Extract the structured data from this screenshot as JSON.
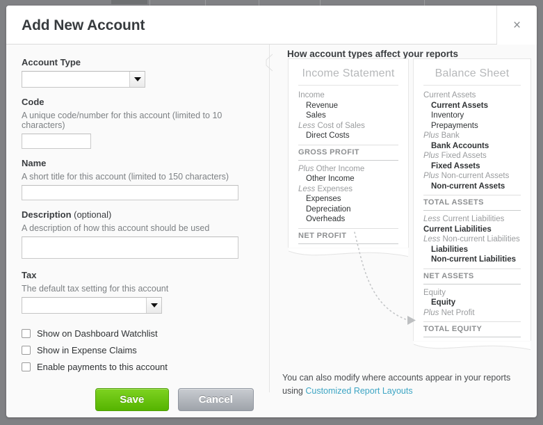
{
  "modal": {
    "title": "Add New Account",
    "close_icon": "close-icon",
    "close_glyph": "×"
  },
  "form": {
    "account_type": {
      "label": "Account Type",
      "value": "",
      "arrow_icon": "chevron-down-icon"
    },
    "code": {
      "label": "Code",
      "help": "A unique code/number for this account (limited to 10 characters)",
      "value": ""
    },
    "name": {
      "label": "Name",
      "help": "A short title for this account (limited to 150 characters)",
      "value": ""
    },
    "description": {
      "label": "Description",
      "optional_suffix": " (optional)",
      "help": "A description of how this account should be used",
      "value": ""
    },
    "tax": {
      "label": "Tax",
      "help": "The default tax setting for this account",
      "value": "",
      "arrow_icon": "chevron-down-icon"
    },
    "checkboxes": [
      {
        "label": "Show on Dashboard Watchlist",
        "checked": false
      },
      {
        "label": "Show in Expense Claims",
        "checked": false
      },
      {
        "label": "Enable payments to this account",
        "checked": false
      }
    ],
    "buttons": {
      "save": "Save",
      "cancel": "Cancel"
    }
  },
  "info": {
    "heading": "How account types affect your reports",
    "footer_text": "You can also modify where accounts appear in your reports using ",
    "footer_link": "Customized Report Layouts",
    "income_statement": {
      "title": "Income Statement",
      "rows": [
        {
          "type": "group",
          "kw": "",
          "text": "Income"
        },
        {
          "type": "item",
          "text": "Revenue"
        },
        {
          "type": "item",
          "text": "Sales"
        },
        {
          "type": "group",
          "kw": "Less ",
          "text": "Cost of Sales"
        },
        {
          "type": "item",
          "text": "Direct Costs"
        },
        {
          "type": "total",
          "text": "GROSS PROFIT"
        },
        {
          "type": "group",
          "kw": "Plus ",
          "text": "Other Income"
        },
        {
          "type": "item",
          "text": "Other Income"
        },
        {
          "type": "group",
          "kw": "Less ",
          "text": "Expenses"
        },
        {
          "type": "item",
          "text": "Expenses"
        },
        {
          "type": "item",
          "text": "Depreciation"
        },
        {
          "type": "item",
          "text": "Overheads"
        },
        {
          "type": "total",
          "text": "NET PROFIT"
        }
      ]
    },
    "balance_sheet": {
      "title": "Balance Sheet",
      "rows": [
        {
          "type": "group",
          "kw": "",
          "text": "Current Assets"
        },
        {
          "type": "item",
          "bold": true,
          "text": "Current Assets"
        },
        {
          "type": "item",
          "text": "Inventory"
        },
        {
          "type": "item",
          "text": "Prepayments"
        },
        {
          "type": "group",
          "kw": "Plus ",
          "text": "Bank"
        },
        {
          "type": "item",
          "bold": true,
          "text": "Bank Accounts"
        },
        {
          "type": "group",
          "kw": "Plus ",
          "text": "Fixed Assets"
        },
        {
          "type": "item",
          "bold": true,
          "text": "Fixed Assets"
        },
        {
          "type": "group",
          "kw": "Plus ",
          "text": "Non-current Assets"
        },
        {
          "type": "item",
          "bold": true,
          "text": "Non-current Assets"
        },
        {
          "type": "total",
          "text": "TOTAL ASSETS"
        },
        {
          "type": "group",
          "kw": "Less ",
          "text": "Current Liabilities"
        },
        {
          "type": "item",
          "bold": true,
          "text": "Current Liabilities",
          "flush": true
        },
        {
          "type": "group",
          "kw": "Less ",
          "text": "Non-current Liabilities"
        },
        {
          "type": "item",
          "bold": true,
          "text": "Liabilities"
        },
        {
          "type": "item",
          "bold": true,
          "text": "Non-current Liabilities"
        },
        {
          "type": "total",
          "text": "NET ASSETS"
        },
        {
          "type": "group",
          "kw": "",
          "text": "Equity"
        },
        {
          "type": "item",
          "bold": true,
          "text": "Equity"
        },
        {
          "type": "group",
          "kw": "Plus ",
          "text": "Net Profit"
        },
        {
          "type": "total",
          "text": "TOTAL EQUITY"
        }
      ]
    }
  },
  "colors": {
    "accent_green": "#7ed321",
    "link_blue": "#3da5c4",
    "backdrop": "#808184"
  }
}
